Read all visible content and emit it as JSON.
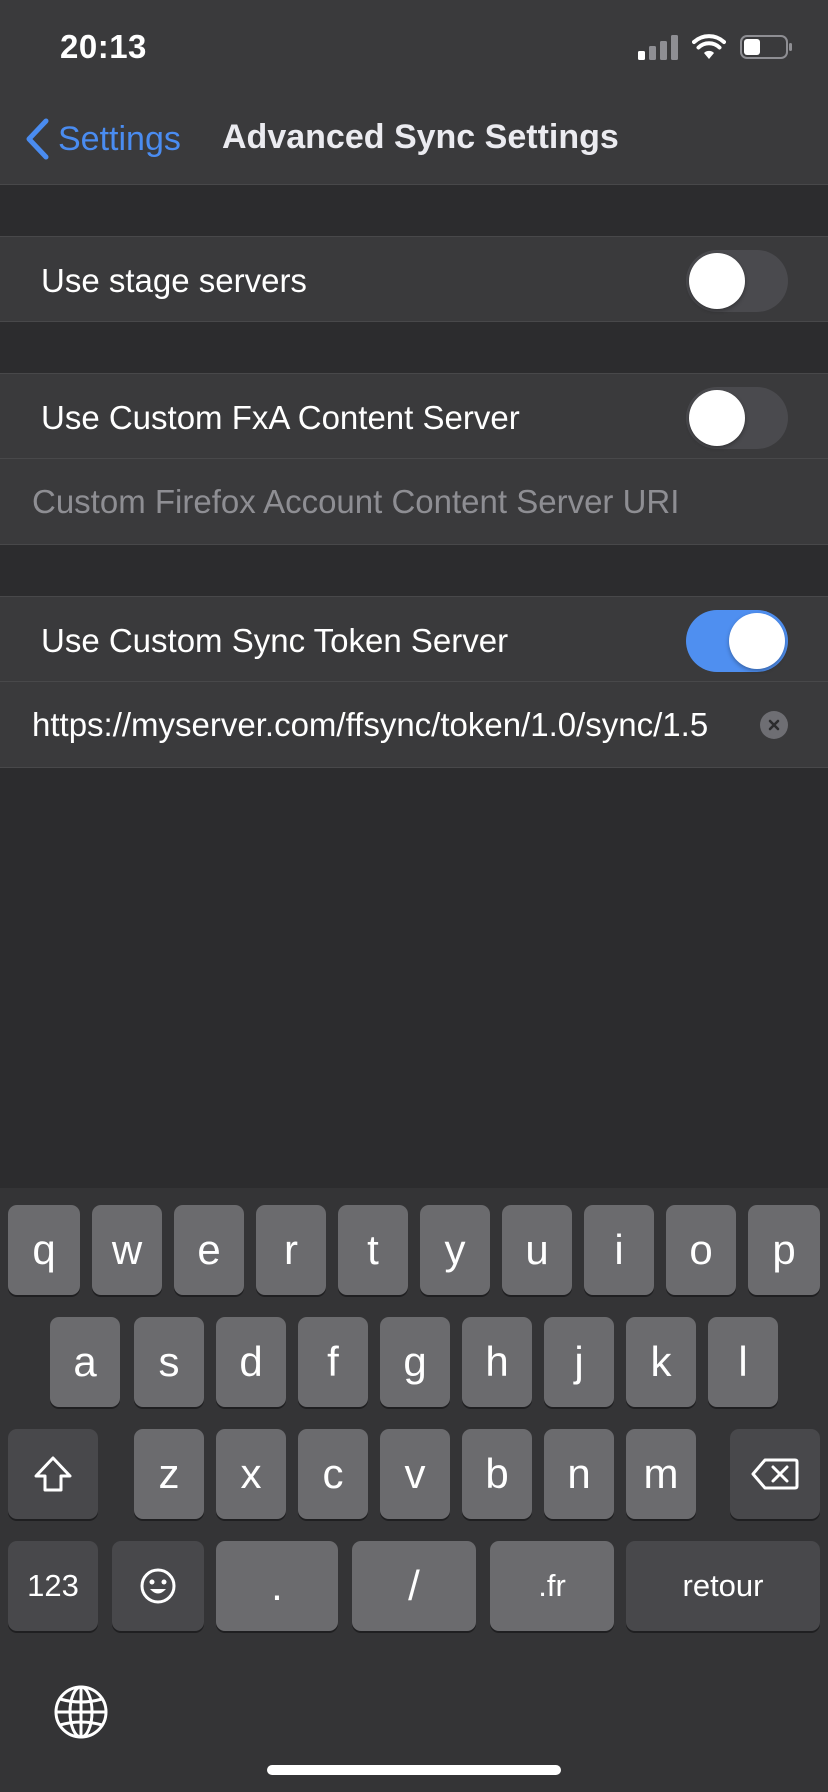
{
  "status_bar": {
    "time": "20:13"
  },
  "nav": {
    "back_label": "Settings",
    "title": "Advanced Sync Settings"
  },
  "rows": {
    "stage": {
      "label": "Use stage servers",
      "enabled": false
    },
    "fxa": {
      "label": "Use Custom FxA Content Server",
      "enabled": false,
      "uri_placeholder": "Custom Firefox Account Content Server URI"
    },
    "sync": {
      "label": "Use Custom Sync Token Server",
      "enabled": true,
      "uri_value": "https://myserver.com/ffsync/token/1.0/sync/1.5"
    }
  },
  "keyboard": {
    "row1": [
      "q",
      "w",
      "e",
      "r",
      "t",
      "y",
      "u",
      "i",
      "o",
      "p"
    ],
    "row2": [
      "a",
      "s",
      "d",
      "f",
      "g",
      "h",
      "j",
      "k",
      "l"
    ],
    "row3": [
      "z",
      "x",
      "c",
      "v",
      "b",
      "n",
      "m"
    ],
    "bottom": {
      "numbers": "123",
      "dot": ".",
      "slash": "/",
      "domain": ".fr",
      "return": "retour"
    }
  },
  "colors": {
    "accent": "#4a8cf1",
    "toggle_on": "#4f8ff0"
  },
  "icons": [
    "back-chevron-icon",
    "wifi-icon",
    "battery-icon",
    "signal-icon",
    "clear-icon",
    "shift-icon",
    "backspace-icon",
    "emoji-icon",
    "globe-icon"
  ]
}
